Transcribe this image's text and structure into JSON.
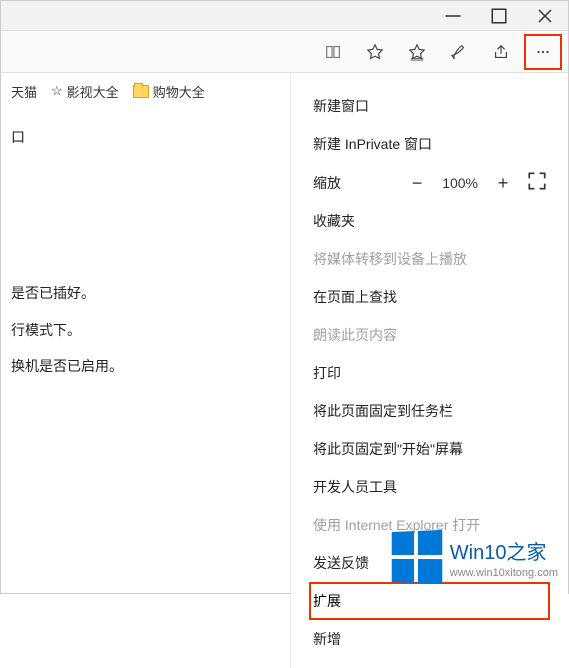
{
  "titlebar": {
    "minimize": "minimize",
    "maximize": "maximize",
    "close": "close"
  },
  "toolbar": {
    "reading_view": "reading-view",
    "favorite": "favorite",
    "favorites_list": "favorites-list",
    "notes": "notes",
    "share": "share",
    "more": "more"
  },
  "bookmarks": {
    "items": [
      {
        "label": "天猫",
        "type": "link"
      },
      {
        "label": "影视大全",
        "type": "star"
      },
      {
        "label": "购物大全",
        "type": "folder"
      }
    ]
  },
  "content": {
    "lines": [
      "口",
      "是否已插好。",
      "行模式下。",
      "换机是否已启用。"
    ]
  },
  "menu": {
    "new_window": "新建窗口",
    "new_inprivate": "新建 InPrivate 窗口",
    "zoom_label": "缩放",
    "zoom_value": "100%",
    "favorites": "收藏夹",
    "cast_media": "将媒体转移到设备上播放",
    "find_on_page": "在页面上查找",
    "read_aloud": "朗读此页内容",
    "print": "打印",
    "pin_taskbar": "将此页面固定到任务栏",
    "pin_start": "将此页固定到\"开始\"屏幕",
    "dev_tools": "开发人员工具",
    "open_ie": "使用 Internet Explorer 打开",
    "send_feedback": "发送反馈",
    "extensions": "扩展",
    "whats_new": "新增"
  },
  "watermark": {
    "title": "Win10之家",
    "url": "www.win10xitong.com"
  }
}
